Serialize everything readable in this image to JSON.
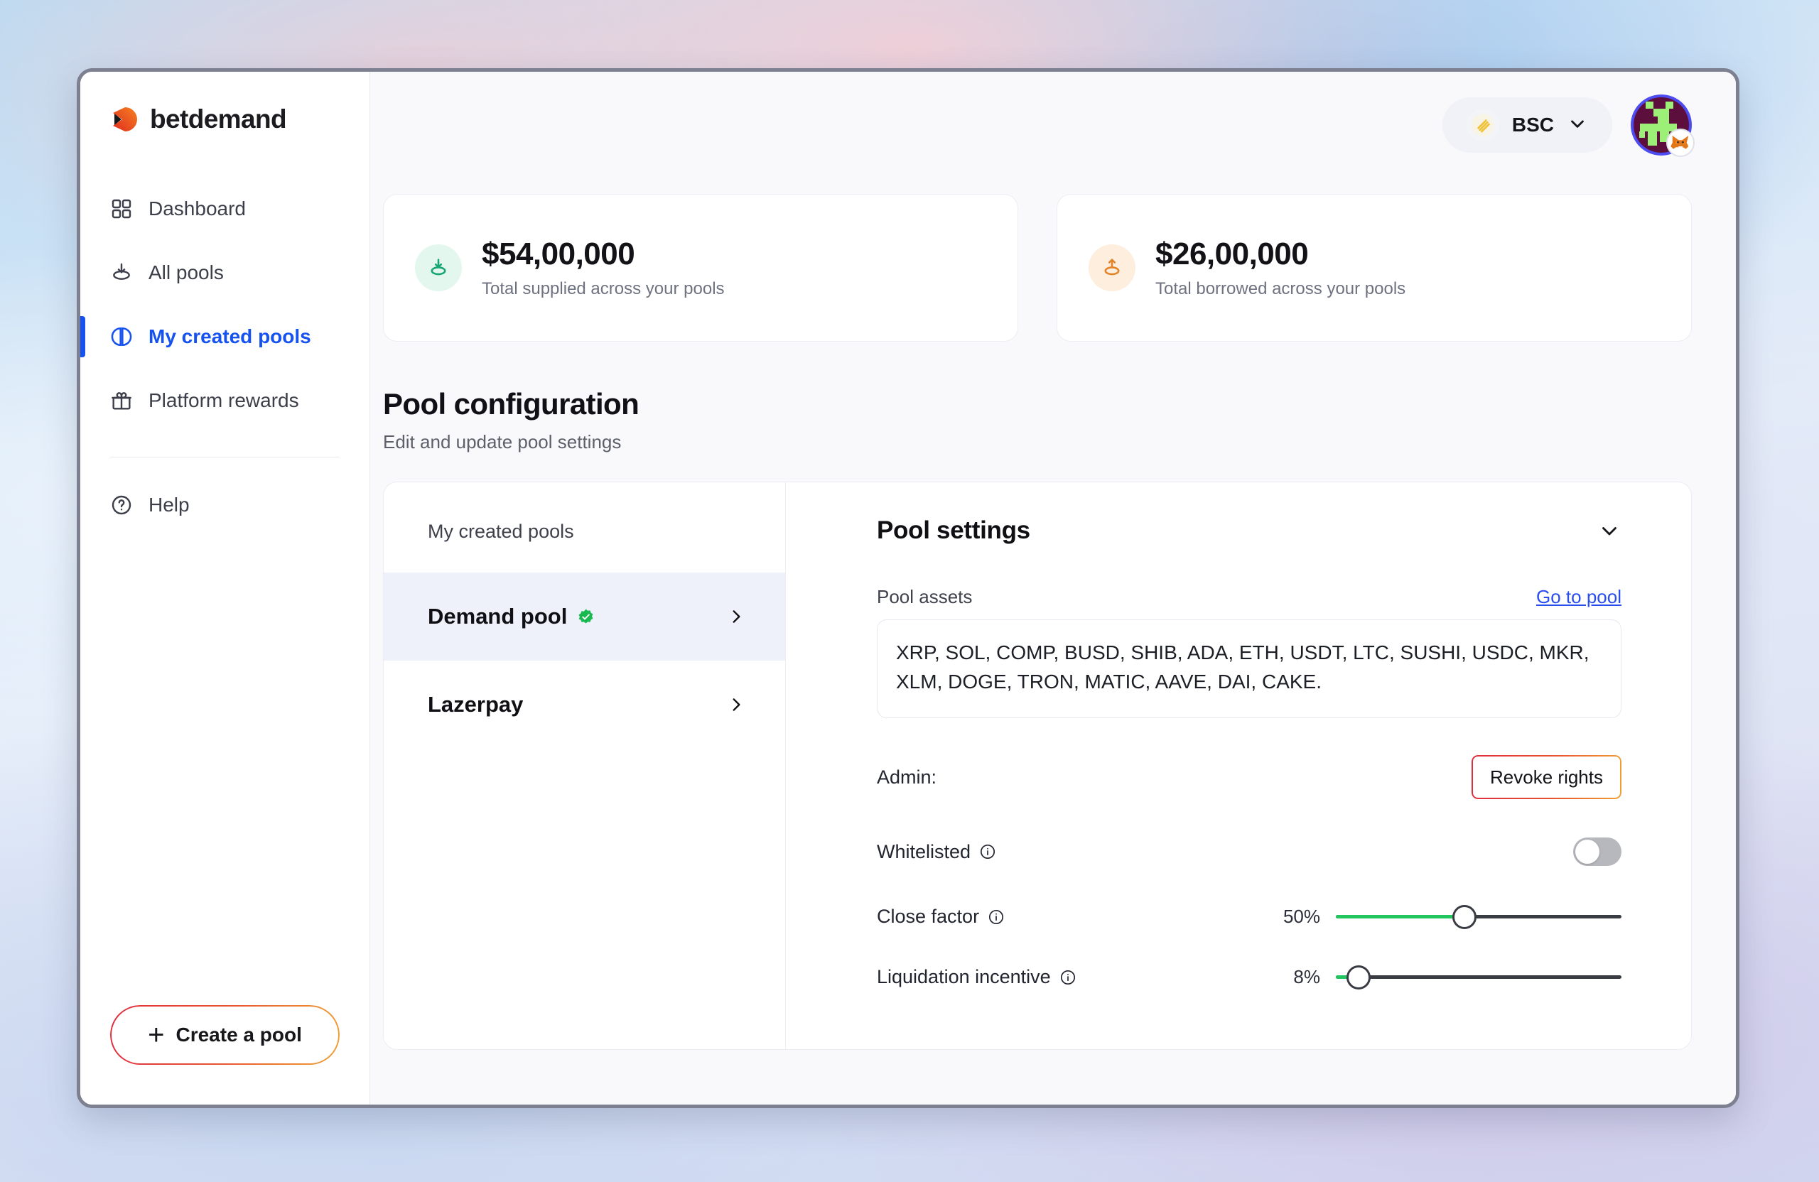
{
  "brand": {
    "name": "betdemand",
    "logo_icon": "betdemand-play-logo"
  },
  "sidebar": {
    "items": [
      {
        "label": "Dashboard",
        "icon": "grid-icon",
        "active": false
      },
      {
        "label": "All pools",
        "icon": "download-pool-icon",
        "active": false
      },
      {
        "label": "My created pools",
        "icon": "split-circle-icon",
        "active": true
      },
      {
        "label": "Platform rewards",
        "icon": "gift-icon",
        "active": false
      }
    ],
    "help": {
      "label": "Help",
      "icon": "question-circle-icon"
    },
    "create_pool_label": "Create a pool",
    "create_pool_icon": "plus-icon"
  },
  "topbar": {
    "chain": {
      "label": "BSC",
      "icon": "bnb-icon",
      "chevron": "chevron-down-icon"
    },
    "avatar": {
      "name": "wallet-avatar",
      "wallet_badge": "metamask-fox-icon"
    }
  },
  "stats": [
    {
      "value": "$54,00,000",
      "label": "Total supplied across your pools",
      "icon": "supply-down-icon",
      "accent": "#17a673"
    },
    {
      "value": "$26,00,000",
      "label": "Total borrowed across your pools",
      "icon": "borrow-up-icon",
      "accent": "#e4842a"
    }
  ],
  "section": {
    "title": "Pool configuration",
    "subtitle": "Edit and update pool settings"
  },
  "pool_list": {
    "heading": "My created pools",
    "items": [
      {
        "name": "Demand pool",
        "verified": true,
        "selected": true,
        "chevron": "chevron-right-icon"
      },
      {
        "name": "Lazerpay",
        "verified": false,
        "selected": false,
        "chevron": "chevron-right-icon"
      }
    ]
  },
  "pool_settings": {
    "title": "Pool settings",
    "collapse_icon": "chevron-down-icon",
    "assets_label": "Pool assets",
    "go_to_pool_label": "Go to pool",
    "assets_value": "XRP, SOL, COMP, BUSD, SHIB, ADA, ETH, USDT, LTC, SUSHI, USDC, MKR, XLM, DOGE, TRON, MATIC, AAVE, DAI, CAKE.",
    "admin_label": "Admin:",
    "revoke_label": "Revoke rights",
    "whitelisted_label": "Whitelisted",
    "whitelisted_on": false,
    "close_factor_label": "Close factor",
    "close_factor_value": "50%",
    "close_factor_fill_pct": 45,
    "liquidation_label": "Liquidation incentive",
    "liquidation_value": "8%",
    "liquidation_fill_pct": 8
  },
  "colors": {
    "accent_blue": "#1552f0",
    "link_blue": "#2a4dee",
    "slider_green": "#22c55e",
    "gradient_start": "#e02b3f",
    "gradient_end": "#efa133",
    "selected_row": "#eef0fa"
  }
}
